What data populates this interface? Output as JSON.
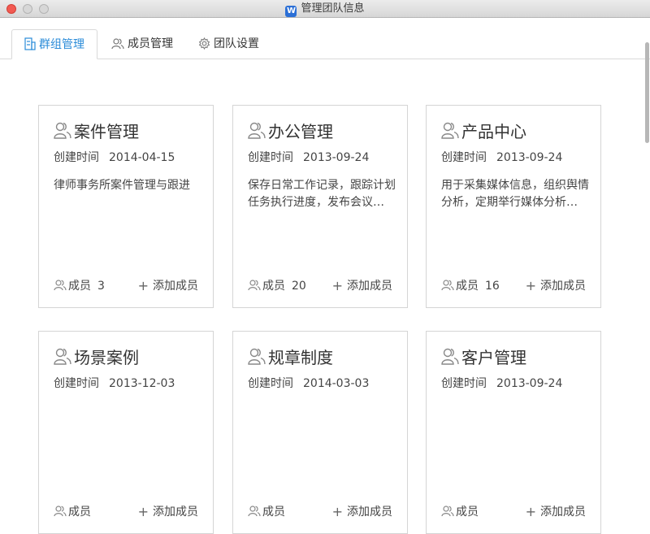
{
  "window": {
    "title": "管理团队信息",
    "app_icon_letter": "W"
  },
  "tabs": [
    {
      "label": "群组管理",
      "icon": "group-manage-icon",
      "active": true
    },
    {
      "label": "成员管理",
      "icon": "members-icon",
      "active": false
    },
    {
      "label": "团队设置",
      "icon": "gear-icon",
      "active": false
    }
  ],
  "labels": {
    "created": "创建时间",
    "members": "成员",
    "add_member": "添加成员"
  },
  "groups": [
    {
      "name": "案件管理",
      "created": "2014-04-15",
      "desc": "律师事务所案件管理与跟进",
      "members": "3"
    },
    {
      "name": "办公管理",
      "created": "2013-09-24",
      "desc": "保存日常工作记录，跟踪计划任务执行进度，发布会议…",
      "members": "20"
    },
    {
      "name": "产品中心",
      "created": "2013-09-24",
      "desc": "用于采集媒体信息，组织舆情分析，定期举行媒体分析…",
      "members": "16"
    },
    {
      "name": "场景案例",
      "created": "2013-12-03",
      "desc": "",
      "members": ""
    },
    {
      "name": "规章制度",
      "created": "2014-03-03",
      "desc": "",
      "members": ""
    },
    {
      "name": "客户管理",
      "created": "2013-09-24",
      "desc": "",
      "members": ""
    }
  ],
  "colors": {
    "accent": "#2a8bd8",
    "close": "#f25a52"
  }
}
